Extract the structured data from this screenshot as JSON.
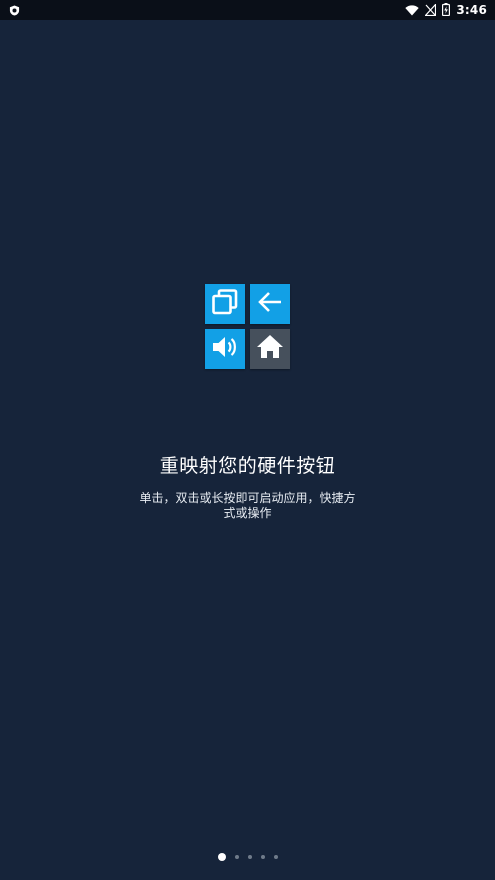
{
  "status_bar": {
    "time": "3:46",
    "icons": [
      "shield-icon",
      "wifi-icon",
      "signal-off-icon",
      "battery-charging-icon"
    ]
  },
  "feature_icons": [
    "recents-icon",
    "back-arrow-icon",
    "volume-icon",
    "home-icon"
  ],
  "colors": {
    "background": "#16243a",
    "status_bar": "#0a0f18",
    "tile_blue": "#12a0e6",
    "tile_gray": "#46505c"
  },
  "onboarding": {
    "title": "重映射您的硬件按钮",
    "description": "单击，双击或长按即可启动应用，快捷方式或操作"
  },
  "pager": {
    "total_pages": 5,
    "current_page": 1
  }
}
